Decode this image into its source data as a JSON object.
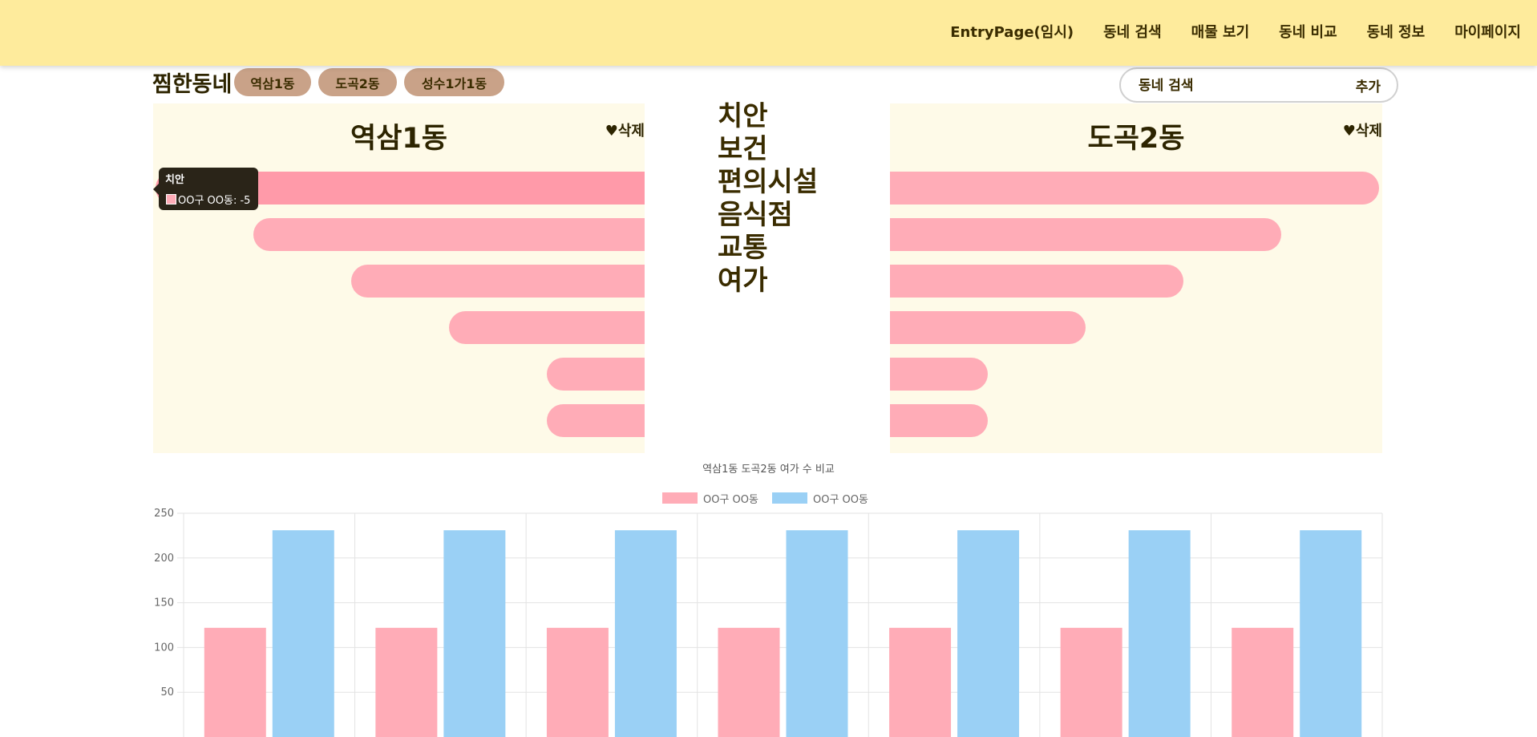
{
  "nav": {
    "items": [
      "EntryPage(임시)",
      "동네 검색",
      "매물 보기",
      "동네 비교",
      "동네 정보",
      "마이페이지"
    ]
  },
  "favorites": {
    "title": "찜한동네",
    "chips": [
      "역삼1동",
      "도곡2동",
      "성수1가1동"
    ]
  },
  "search": {
    "placeholder": "동네 검색",
    "add_label": "추가"
  },
  "compare": {
    "left": {
      "name": "역삼1동",
      "delete_label": "♥삭제"
    },
    "right": {
      "name": "도곡2동",
      "delete_label": "♥삭제"
    },
    "categories": [
      "치안",
      "보건",
      "편의시설",
      "음식점",
      "교통",
      "여가"
    ],
    "left_values": [
      -5,
      -4,
      -3,
      -2,
      -1,
      -1
    ],
    "right_values": [
      5,
      4,
      3,
      2,
      1,
      1
    ],
    "tooltip": {
      "title": "치안",
      "line": "OO구 OO동: -5"
    }
  },
  "colors": {
    "pink": "#ffacb7",
    "blue": "#9ad0f5",
    "panel": "#fefae8",
    "header": "#feeb9c"
  },
  "chart_data": {
    "type": "bar",
    "title": "역삼1동 도곡2동 여가 수 비교",
    "categories": [
      "",
      "",
      "",
      "",
      "",
      "",
      ""
    ],
    "series": [
      {
        "name": "OO구 OO동",
        "color": "#ffacb7",
        "values": [
          122,
          122,
          122,
          122,
          122,
          122,
          122
        ]
      },
      {
        "name": "OO구 OO동",
        "color": "#9ad0f5",
        "values": [
          231,
          231,
          231,
          231,
          231,
          231,
          231
        ]
      }
    ],
    "ylim": [
      0,
      250
    ],
    "yticks": [
      50,
      100,
      150,
      200,
      250
    ],
    "grid": true,
    "legend": "top"
  }
}
